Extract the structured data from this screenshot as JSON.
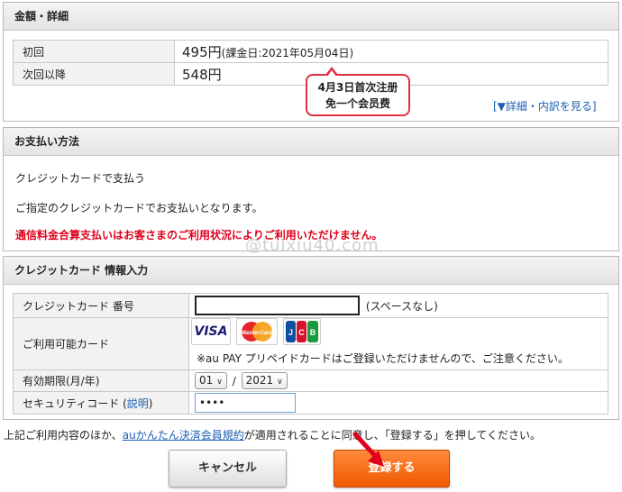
{
  "amount_panel": {
    "title": "金額・詳細",
    "rows": [
      {
        "label": "初回",
        "price": "495円",
        "note": "(課金日:2021年05月04日)"
      },
      {
        "label": "次回以降",
        "price": "548円"
      }
    ],
    "detail_link": "[▼詳細・内訳を見る]",
    "annotation_line1": "4月3日首次注册",
    "annotation_line2": "免一个会员费"
  },
  "payment_panel": {
    "title": "お支払い方法",
    "method": "クレジットカードで支払う",
    "info": "ご指定のクレジットカードでお支払いとなります。",
    "warning": "通信料金合算支払いはお客さまのご利用状況によりご利用いただけません。"
  },
  "watermark": "@tuixiu40.com",
  "card_panel": {
    "title": "クレジットカード 情報入力",
    "number_label": "クレジットカード 番号",
    "number_hint": "(スペースなし)",
    "available_label": "ご利用可能カード",
    "brands": [
      "VISA",
      "MasterCard",
      "JCB"
    ],
    "available_note": "※au PAY プリペイドカードはご登録いただけませんので、ご注意ください。",
    "expiry_label": "有効期限(月/年)",
    "expiry_month": "01",
    "expiry_separator": "/",
    "expiry_year": "2021",
    "cvv_label_prefix": "セキュリティコード (",
    "cvv_help_link": "説明",
    "cvv_label_suffix": ")",
    "cvv_value": "••••"
  },
  "agreement": {
    "prefix": "上記ご利用内容のほか、",
    "link": "auかんたん決済会員規約",
    "suffix": "が適用されることに同意し、「登録する」を押してください。"
  },
  "buttons": {
    "cancel": "キャンセル",
    "submit": "登録する"
  },
  "colors": {
    "warning": "#e0001c",
    "link": "#1a5fb4",
    "submit": "#ee5a00",
    "annotation_border": "#e03040",
    "arrow": "#e0001c"
  }
}
